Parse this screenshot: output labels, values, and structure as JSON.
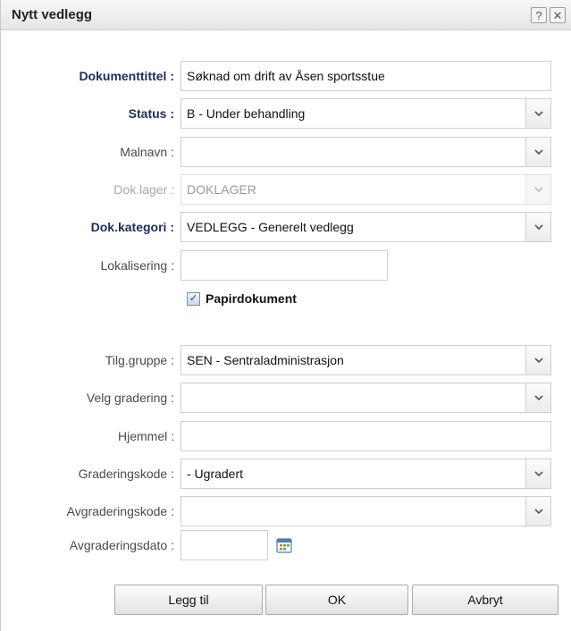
{
  "dialog": {
    "title": "Nytt vedlegg",
    "help_glyph": "?",
    "close_glyph": "✕"
  },
  "form": {
    "dokumenttittel": {
      "label": "Dokumenttittel :",
      "value": "Søknad om drift av Åsen sportsstue"
    },
    "status": {
      "label": "Status :",
      "value": "B - Under behandling"
    },
    "malnavn": {
      "label": "Malnavn :",
      "value": ""
    },
    "doklager": {
      "label": "Dok.lager :",
      "value": "DOKLAGER"
    },
    "dokkategori": {
      "label": "Dok.kategori :",
      "value": "VEDLEGG - Generelt vedlegg"
    },
    "lokalisering": {
      "label": "Lokalisering :",
      "value": ""
    },
    "papirdokument": {
      "label": "Papirdokument",
      "checked": true
    },
    "tilggruppe": {
      "label": "Tilg.gruppe :",
      "value": "SEN - Sentraladministrasjon"
    },
    "velggradering": {
      "label": "Velg gradering :",
      "value": ""
    },
    "hjemmel": {
      "label": "Hjemmel :",
      "value": ""
    },
    "graderingskode": {
      "label": "Graderingskode :",
      "value": "- Ugradert"
    },
    "avgraderingskode": {
      "label": "Avgraderingskode :",
      "value": ""
    },
    "avgraderingsdato": {
      "label": "Avgraderingsdato :",
      "value": ""
    }
  },
  "buttons": {
    "add": "Legg til",
    "ok": "OK",
    "cancel": "Avbryt"
  },
  "colors": {
    "label_bold": "#1c2f55",
    "label_normal": "#4a4a4a",
    "label_disabled": "#a8a8a8"
  }
}
